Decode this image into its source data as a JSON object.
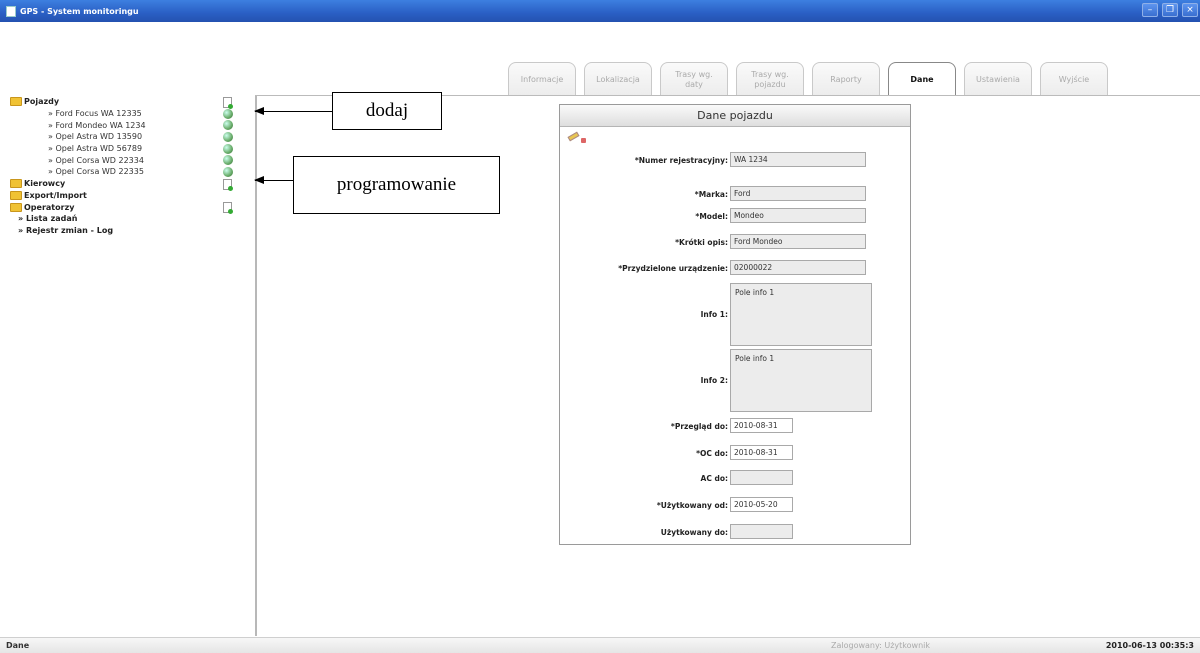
{
  "window": {
    "title": "GPS - System monitoringu"
  },
  "tabs": [
    {
      "label": "Informacje",
      "active": false
    },
    {
      "label": "Lokalizacja",
      "active": false
    },
    {
      "label": "Trasy wg. daty",
      "active": false
    },
    {
      "label": "Trasy wg. pojazdu",
      "active": false
    },
    {
      "label": "Raporty",
      "active": false
    },
    {
      "label": "Dane",
      "active": true
    },
    {
      "label": "Ustawienia",
      "active": false
    },
    {
      "label": "Wyjście",
      "active": false
    }
  ],
  "sidebar": {
    "vehicles_folder": "Pojazdy",
    "vehicles": [
      "» Ford Focus WA 12335",
      "» Ford Mondeo WA 1234",
      "» Opel Astra WD 13590",
      "» Opel Astra WD 56789",
      "» Opel Corsa WD 22334",
      "» Opel Corsa WD 22335"
    ],
    "drivers_folder": "Kierowcy",
    "export_folder": "Export/Import",
    "operators_folder": "Operatorzy",
    "tasks_item": "» Lista zadań",
    "log_item": "» Rejestr zmian - Log"
  },
  "annotations": {
    "add": "dodaj",
    "programming": "programowanie"
  },
  "form": {
    "title": "Dane pojazdu",
    "registration_label": "*Numer rejestracyjny:",
    "registration_value": "WA 1234",
    "make_label": "*Marka:",
    "make_value": "Ford",
    "model_label": "*Model:",
    "model_value": "Mondeo",
    "short_desc_label": "*Krótki opis:",
    "short_desc_value": "Ford Mondeo",
    "device_label": "*Przydzielone urządzenie:",
    "device_value": "02000022",
    "info1_label": "Info 1:",
    "info1_value": "Pole info 1",
    "info2_label": "Info 2:",
    "info2_value": "Pole info 1",
    "inspection_label": "*Przegląd do:",
    "inspection_value": "2010-08-31",
    "oc_label": "*OC do:",
    "oc_value": "2010-08-31",
    "ac_label": "AC do:",
    "ac_value": "",
    "used_from_label": "*Użytkowany od:",
    "used_from_value": "2010-05-20",
    "used_to_label": "Użytkowany do:",
    "used_to_value": ""
  },
  "statusbar": {
    "left": "Dane",
    "user": "Zalogowany: Użytkownik",
    "datetime": "2010-06-13 00:35:3"
  }
}
